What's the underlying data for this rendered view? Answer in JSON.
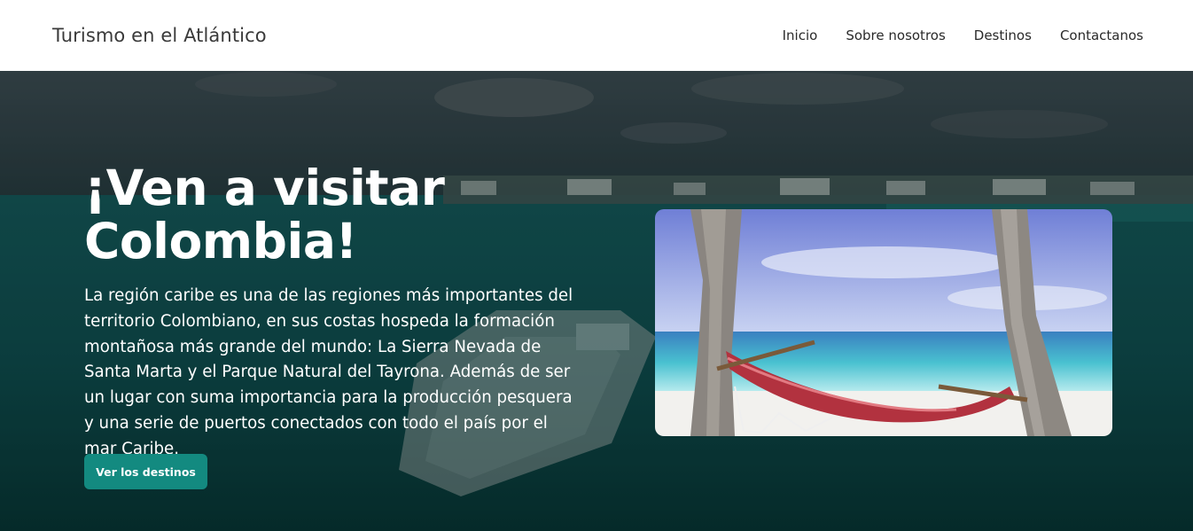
{
  "navbar": {
    "brand": "Turismo en el Atlántico",
    "links": [
      "Inicio",
      "Sobre nosotros",
      "Destinos",
      "Contactanos"
    ]
  },
  "hero": {
    "title": "¡Ven a visitar Colombia!",
    "description": "La región caribe es una de las regiones más importantes del territorio Colombiano, en sus costas hospeda la formación montañosa más grande del mundo: La Sierra Nevada de Santa Marta y el Parque Natural del Tayrona. Además de ser un lugar con suma importancia para la producción pesquera y una serie de puertos conectados con todo el país por el mar Caribe.",
    "cta_label": "Ver los destinos",
    "background_image": "ocean-boat-photo",
    "side_image": "beach-hammock-photo"
  },
  "colors": {
    "navbar_bg": "#ffffff",
    "brand_text": "#3a3a3a",
    "cta_bg": "#138a80",
    "hero_text": "#ffffff"
  }
}
